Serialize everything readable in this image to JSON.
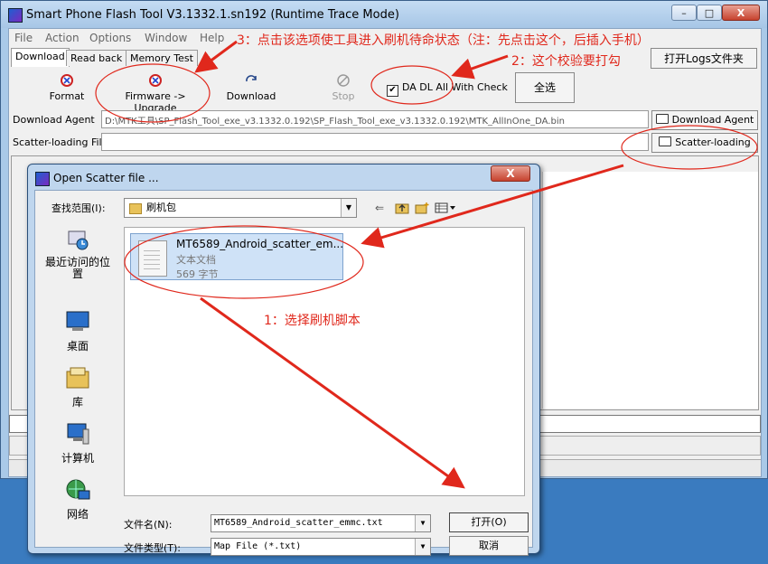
{
  "window": {
    "title": "Smart Phone Flash Tool V3.1332.1.sn192 (Runtime Trace Mode)",
    "min": "–",
    "max": "□",
    "close": "X"
  },
  "menu": [
    "File",
    "Action",
    "Options",
    "Window",
    "Help"
  ],
  "tabs": [
    "Download",
    "Read back",
    "Memory Test"
  ],
  "logs_button": "打开Logs文件夹",
  "toolbar": {
    "format": "Format",
    "firmware_upgrade": "Firmware -> Upgrade",
    "download": "Download",
    "stop": "Stop",
    "da_check": "DA DL All With Check",
    "select_all": "全选"
  },
  "fields": {
    "download_agent_label": "Download Agent",
    "download_agent_path": "D:\\MTK工具\\SP_Flash_Tool_exe_v3.1332.0.192\\SP_Flash_Tool_exe_v3.1332.0.192\\MTK_AllInOne_DA.bin",
    "scatter_label": "Scatter-loading File",
    "scatter_path": "",
    "download_agent_button": "Download Agent",
    "scatter_button": "Scatter-loading"
  },
  "dialog": {
    "title": "Open Scatter file ...",
    "close": "X",
    "look_in_label": "查找范围(I):",
    "look_in_value": "刷机包",
    "places": [
      "最近访问的位置",
      "桌面",
      "库",
      "计算机",
      "网络"
    ],
    "file": {
      "name": "MT6589_Android_scatter_em...",
      "type": "文本文档",
      "size": "569 字节"
    },
    "filename_label": "文件名(N):",
    "filename_value": "MT6589_Android_scatter_emmc.txt",
    "filetype_label": "文件类型(T):",
    "filetype_value": "Map File (*.txt)",
    "open_button": "打开(O)",
    "cancel_button": "取消"
  },
  "annotations": {
    "step1": "1：选择刷机脚本",
    "step2": "2：这个校验要打勾",
    "step3": "3：点击该选项使工具进入刷机待命状态（注：先点击这个，后插入手机）"
  },
  "colors": {
    "annotation": "#e0281c",
    "window_frame": "#a9c9e8",
    "selection": "#cfe2f7"
  }
}
